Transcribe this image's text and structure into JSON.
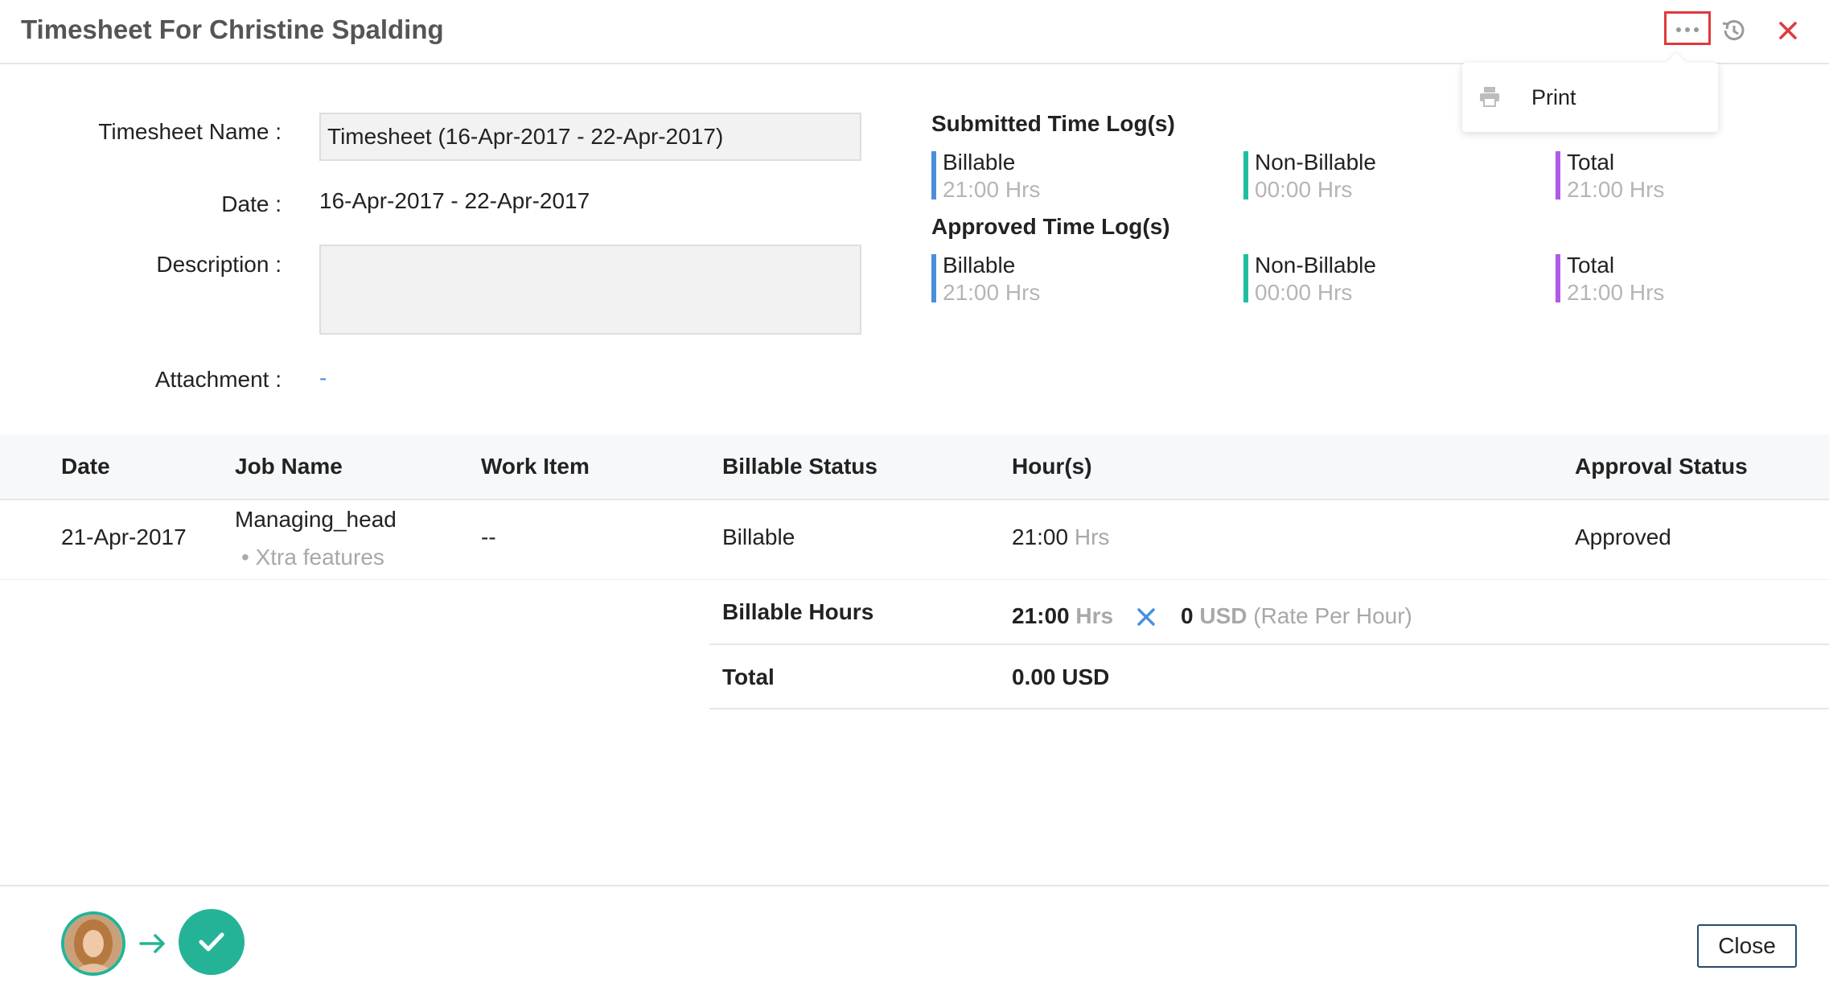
{
  "header": {
    "title": "Timesheet For Christine Spalding"
  },
  "menu": {
    "print_label": "Print"
  },
  "form": {
    "name_label": "Timesheet Name :",
    "name_value": "Timesheet (16-Apr-2017 - 22-Apr-2017)",
    "date_label": "Date :",
    "date_value": "16-Apr-2017 - 22-Apr-2017",
    "description_label": "Description :",
    "description_value": "",
    "attachment_label": "Attachment :",
    "attachment_value": "-"
  },
  "submitted": {
    "title": "Submitted Time Log(s)",
    "billable_label": "Billable",
    "billable_hours": "21:00 Hrs",
    "nonbillable_label": "Non-Billable",
    "nonbillable_hours": "00:00 Hrs",
    "total_label": "Total",
    "total_hours": "21:00 Hrs"
  },
  "approved": {
    "title": "Approved Time Log(s)",
    "billable_label": "Billable",
    "billable_hours": "21:00 Hrs",
    "nonbillable_label": "Non-Billable",
    "nonbillable_hours": "00:00 Hrs",
    "total_label": "Total",
    "total_hours": "21:00 Hrs"
  },
  "table": {
    "headers": [
      "Date",
      "Job Name",
      "Work Item",
      "Billable Status",
      "Hour(s)",
      "Approval Status"
    ],
    "rows": [
      {
        "date": "21-Apr-2017",
        "job_name": "Managing_head",
        "task": "Xtra features",
        "work_item": "--",
        "billable_status": "Billable",
        "hours": "21:00",
        "hours_unit": "Hrs",
        "approval_status": "Approved"
      }
    ]
  },
  "summary": {
    "billable_hours_label": "Billable Hours",
    "billable_hours_value": "21:00",
    "hours_unit": "Hrs",
    "rate_value": "0",
    "rate_currency": "USD",
    "rate_note": "(Rate Per Hour)",
    "total_label": "Total",
    "total_value": "0.00",
    "total_currency": "USD"
  },
  "footer": {
    "close_label": "Close"
  },
  "colors": {
    "billable": "#4a8fdc",
    "nonbillable": "#1fbf9f",
    "total": "#b159e8",
    "accent_red": "#e0393e",
    "approved_green": "#25b397"
  },
  "icons": [
    "more-dots-icon",
    "history-icon",
    "close-icon",
    "printer-icon",
    "multiply-icon",
    "arrow-right-icon",
    "check-icon"
  ]
}
